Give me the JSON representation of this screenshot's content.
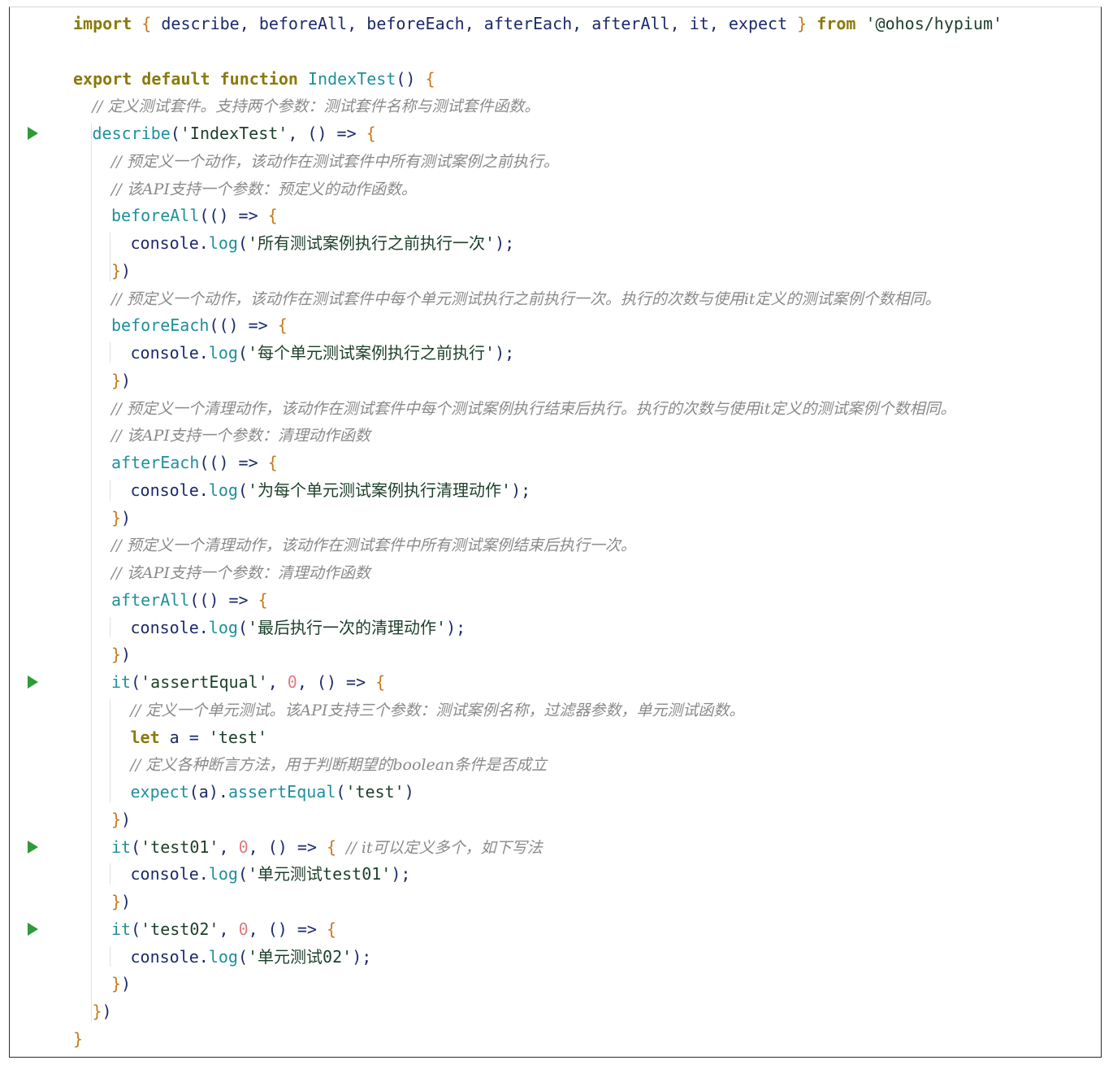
{
  "editor": {
    "lines": [
      {
        "indent": 0,
        "run": false,
        "tokens": [
          [
            "kw",
            "import"
          ],
          [
            "punct",
            " "
          ],
          [
            "br",
            "{"
          ],
          [
            "id",
            " describe"
          ],
          [
            "punct",
            ", "
          ],
          [
            "id",
            "beforeAll"
          ],
          [
            "punct",
            ", "
          ],
          [
            "id",
            "beforeEach"
          ],
          [
            "punct",
            ", "
          ],
          [
            "id",
            "afterEach"
          ],
          [
            "punct",
            ", "
          ],
          [
            "id",
            "afterAll"
          ],
          [
            "punct",
            ", "
          ],
          [
            "id",
            "it"
          ],
          [
            "punct",
            ", "
          ],
          [
            "id",
            "expect"
          ],
          [
            "punct",
            " "
          ],
          [
            "br",
            "}"
          ],
          [
            "punct",
            " "
          ],
          [
            "kw",
            "from"
          ],
          [
            "punct",
            " "
          ],
          [
            "str",
            "'@ohos/hypium'"
          ]
        ]
      },
      {
        "indent": 0,
        "run": false,
        "tokens": []
      },
      {
        "indent": 0,
        "run": false,
        "tokens": [
          [
            "kw",
            "export default function"
          ],
          [
            "punct",
            " "
          ],
          [
            "fn",
            "IndexTest"
          ],
          [
            "punct",
            "() "
          ],
          [
            "br",
            "{"
          ]
        ]
      },
      {
        "indent": 1,
        "run": false,
        "tokens": [
          [
            "cm",
            "// 定义测试套件。支持两个参数：测试套件名称与测试套件函数。"
          ]
        ]
      },
      {
        "indent": 1,
        "run": true,
        "tokens": [
          [
            "fn",
            "describe"
          ],
          [
            "punct",
            "("
          ],
          [
            "str",
            "'IndexTest'"
          ],
          [
            "punct",
            ", () => "
          ],
          [
            "br",
            "{"
          ]
        ]
      },
      {
        "indent": 2,
        "run": false,
        "tokens": [
          [
            "cm",
            "// 预定义一个动作，该动作在测试套件中所有测试案例之前执行。"
          ]
        ]
      },
      {
        "indent": 2,
        "run": false,
        "tokens": [
          [
            "cm",
            "// 该API支持一个参数：预定义的动作函数。"
          ]
        ]
      },
      {
        "indent": 2,
        "run": false,
        "tokens": [
          [
            "fn",
            "beforeAll"
          ],
          [
            "punct",
            "(() => "
          ],
          [
            "br",
            "{"
          ]
        ]
      },
      {
        "indent": 3,
        "run": false,
        "tokens": [
          [
            "id",
            "console"
          ],
          [
            "punct",
            "."
          ],
          [
            "method",
            "log"
          ],
          [
            "punct",
            "("
          ],
          [
            "str",
            "'所有测试案例执行之前执行一次'"
          ],
          [
            "punct",
            ");"
          ]
        ]
      },
      {
        "indent": 2,
        "run": false,
        "tokens": [
          [
            "br",
            "}"
          ],
          [
            "punct",
            ")"
          ]
        ]
      },
      {
        "indent": 2,
        "run": false,
        "tokens": [
          [
            "cm",
            "// 预定义一个动作，该动作在测试套件中每个单元测试执行之前执行一次。执行的次数与使用it定义的测试案例个数相同。"
          ]
        ]
      },
      {
        "indent": 2,
        "run": false,
        "tokens": [
          [
            "fn",
            "beforeEach"
          ],
          [
            "punct",
            "(() => "
          ],
          [
            "br",
            "{"
          ]
        ]
      },
      {
        "indent": 3,
        "run": false,
        "tokens": [
          [
            "id",
            "console"
          ],
          [
            "punct",
            "."
          ],
          [
            "method",
            "log"
          ],
          [
            "punct",
            "("
          ],
          [
            "str",
            "'每个单元测试案例执行之前执行'"
          ],
          [
            "punct",
            ");"
          ]
        ]
      },
      {
        "indent": 2,
        "run": false,
        "tokens": [
          [
            "br",
            "}"
          ],
          [
            "punct",
            ")"
          ]
        ]
      },
      {
        "indent": 2,
        "run": false,
        "tokens": [
          [
            "cm",
            "// 预定义一个清理动作，该动作在测试套件中每个测试案例执行结束后执行。执行的次数与使用it定义的测试案例个数相同。"
          ]
        ]
      },
      {
        "indent": 2,
        "run": false,
        "tokens": [
          [
            "cm",
            "// 该API支持一个参数：清理动作函数"
          ]
        ]
      },
      {
        "indent": 2,
        "run": false,
        "tokens": [
          [
            "fn",
            "afterEach"
          ],
          [
            "punct",
            "(() => "
          ],
          [
            "br",
            "{"
          ]
        ]
      },
      {
        "indent": 3,
        "run": false,
        "tokens": [
          [
            "id",
            "console"
          ],
          [
            "punct",
            "."
          ],
          [
            "method",
            "log"
          ],
          [
            "punct",
            "("
          ],
          [
            "str",
            "'为每个单元测试案例执行清理动作'"
          ],
          [
            "punct",
            ");"
          ]
        ]
      },
      {
        "indent": 2,
        "run": false,
        "tokens": [
          [
            "br",
            "}"
          ],
          [
            "punct",
            ")"
          ]
        ]
      },
      {
        "indent": 2,
        "run": false,
        "tokens": [
          [
            "cm",
            "// 预定义一个清理动作，该动作在测试套件中所有测试案例结束后执行一次。"
          ]
        ]
      },
      {
        "indent": 2,
        "run": false,
        "tokens": [
          [
            "cm",
            "// 该API支持一个参数：清理动作函数"
          ]
        ]
      },
      {
        "indent": 2,
        "run": false,
        "tokens": [
          [
            "fn",
            "afterAll"
          ],
          [
            "punct",
            "(() => "
          ],
          [
            "br",
            "{"
          ]
        ]
      },
      {
        "indent": 3,
        "run": false,
        "tokens": [
          [
            "id",
            "console"
          ],
          [
            "punct",
            "."
          ],
          [
            "method",
            "log"
          ],
          [
            "punct",
            "("
          ],
          [
            "str",
            "'最后执行一次的清理动作'"
          ],
          [
            "punct",
            ");"
          ]
        ]
      },
      {
        "indent": 2,
        "run": false,
        "tokens": [
          [
            "br",
            "}"
          ],
          [
            "punct",
            ")"
          ]
        ]
      },
      {
        "indent": 2,
        "run": true,
        "tokens": [
          [
            "fn",
            "it"
          ],
          [
            "punct",
            "("
          ],
          [
            "str",
            "'assertEqual'"
          ],
          [
            "punct",
            ", "
          ],
          [
            "num",
            "0"
          ],
          [
            "punct",
            ", () => "
          ],
          [
            "br",
            "{"
          ]
        ]
      },
      {
        "indent": 3,
        "run": false,
        "tokens": [
          [
            "cm",
            "// 定义一个单元测试。该API支持三个参数：测试案例名称，过滤器参数，单元测试函数。"
          ]
        ]
      },
      {
        "indent": 3,
        "run": false,
        "tokens": [
          [
            "kw",
            "let"
          ],
          [
            "punct",
            " "
          ],
          [
            "id",
            "a"
          ],
          [
            "punct",
            " = "
          ],
          [
            "str",
            "'test'"
          ]
        ]
      },
      {
        "indent": 3,
        "run": false,
        "tokens": [
          [
            "cm",
            "// 定义各种断言方法，用于判断期望的boolean条件是否成立"
          ]
        ]
      },
      {
        "indent": 3,
        "run": false,
        "tokens": [
          [
            "fn",
            "expect"
          ],
          [
            "punct",
            "("
          ],
          [
            "id",
            "a"
          ],
          [
            "punct",
            ")."
          ],
          [
            "method",
            "assertEqual"
          ],
          [
            "punct",
            "("
          ],
          [
            "str",
            "'test'"
          ],
          [
            "punct",
            ")"
          ]
        ]
      },
      {
        "indent": 2,
        "run": false,
        "tokens": [
          [
            "br",
            "}"
          ],
          [
            "punct",
            ")"
          ]
        ]
      },
      {
        "indent": 2,
        "run": true,
        "tokens": [
          [
            "fn",
            "it"
          ],
          [
            "punct",
            "("
          ],
          [
            "str",
            "'test01'"
          ],
          [
            "punct",
            ", "
          ],
          [
            "num",
            "0"
          ],
          [
            "punct",
            ", () => "
          ],
          [
            "br",
            "{"
          ],
          [
            "punct",
            " "
          ],
          [
            "cm",
            "// it可以定义多个，如下写法"
          ]
        ]
      },
      {
        "indent": 3,
        "run": false,
        "tokens": [
          [
            "id",
            "console"
          ],
          [
            "punct",
            "."
          ],
          [
            "method",
            "log"
          ],
          [
            "punct",
            "("
          ],
          [
            "str",
            "'单元测试test01'"
          ],
          [
            "punct",
            ");"
          ]
        ]
      },
      {
        "indent": 2,
        "run": false,
        "tokens": [
          [
            "br",
            "}"
          ],
          [
            "punct",
            ")"
          ]
        ]
      },
      {
        "indent": 2,
        "run": true,
        "tokens": [
          [
            "fn",
            "it"
          ],
          [
            "punct",
            "("
          ],
          [
            "str",
            "'test02'"
          ],
          [
            "punct",
            ", "
          ],
          [
            "num",
            "0"
          ],
          [
            "punct",
            ", () => "
          ],
          [
            "br",
            "{"
          ]
        ]
      },
      {
        "indent": 3,
        "run": false,
        "tokens": [
          [
            "id",
            "console"
          ],
          [
            "punct",
            "."
          ],
          [
            "method",
            "log"
          ],
          [
            "punct",
            "("
          ],
          [
            "str",
            "'单元测试02'"
          ],
          [
            "punct",
            ");"
          ]
        ]
      },
      {
        "indent": 2,
        "run": false,
        "tokens": [
          [
            "br",
            "}"
          ],
          [
            "punct",
            ")"
          ]
        ]
      },
      {
        "indent": 1,
        "run": false,
        "tokens": [
          [
            "br",
            "}"
          ],
          [
            "punct",
            ")"
          ]
        ]
      },
      {
        "indent": 0,
        "run": false,
        "tokens": [
          [
            "br",
            "}"
          ]
        ]
      }
    ]
  }
}
